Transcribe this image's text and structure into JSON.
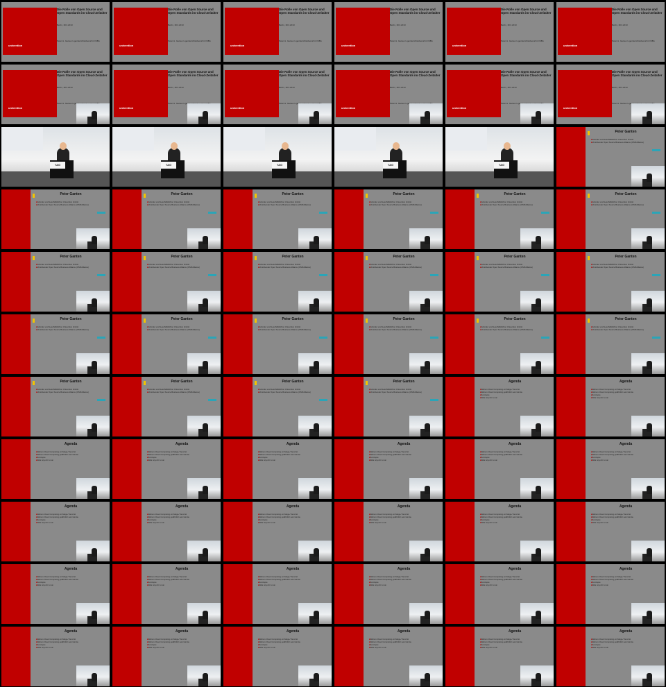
{
  "grid": {
    "columns": 6,
    "rows": 11
  },
  "slides": {
    "title": {
      "title": "Die Rolle von Open Source und Open Standards im Cloud-Zeitalter",
      "date": "Berlin, 18.3.2013",
      "author": "Peter H. Ganten Ligenberichtsübersicht OSBA",
      "logo": "univention"
    },
    "speaker": {
      "heading": "Peter Ganten",
      "bullets": [
        "Gründer und Geschäftsführer Univention GmbH",
        "Vorsitzender Open Source Business Alliance (OSB Alliance)"
      ]
    },
    "agenda": {
      "heading": "Agenda",
      "bullets": [
        "Warum Cloud Computing ein Mega-Trend ist",
        "Warum Cloud Computing gefährlich sein könnte",
        "Konzepte",
        "Was ist jetzt zu tun"
      ]
    },
    "video": {
      "sign": "TAG"
    }
  },
  "frames": [
    "title",
    "title",
    "title",
    "title",
    "title",
    "title",
    "title-pip",
    "title-pip",
    "title-pip",
    "title-pip",
    "title-pip",
    "title-pip",
    "video",
    "video",
    "video",
    "video",
    "video",
    "speaker",
    "speaker",
    "speaker",
    "speaker",
    "speaker",
    "speaker",
    "speaker",
    "speaker",
    "speaker",
    "speaker",
    "speaker",
    "speaker",
    "speaker",
    "speaker",
    "speaker",
    "speaker",
    "speaker",
    "speaker",
    "speaker",
    "speaker",
    "speaker",
    "speaker",
    "speaker",
    "agenda",
    "agenda",
    "agenda",
    "agenda",
    "agenda",
    "agenda",
    "agenda",
    "agenda",
    "agenda",
    "agenda",
    "agenda",
    "agenda",
    "agenda",
    "agenda",
    "agenda",
    "agenda",
    "agenda",
    "agenda",
    "agenda",
    "agenda",
    "agenda",
    "agenda",
    "agenda",
    "agenda",
    "agenda",
    "agenda"
  ]
}
